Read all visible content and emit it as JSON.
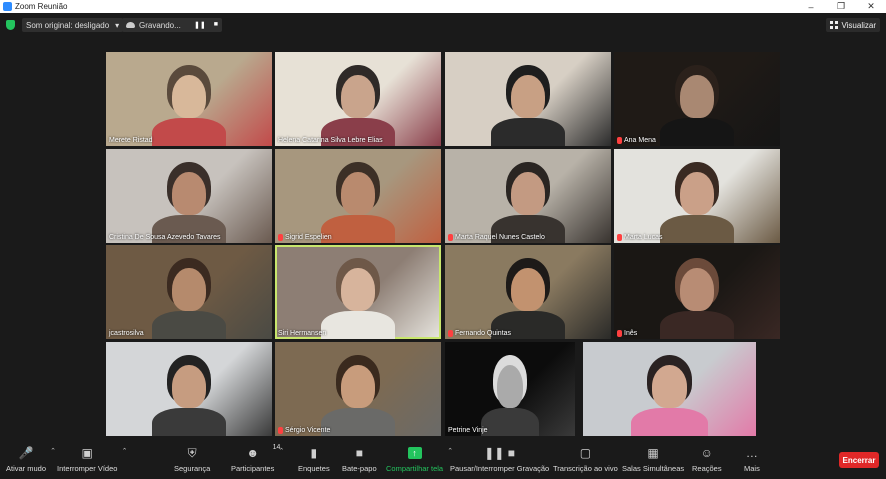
{
  "window": {
    "title": "Zoom Reunião"
  },
  "topbar": {
    "audio_label": "Som original: desligado",
    "recording_label": "Gravando...",
    "view_label": "Visualizar"
  },
  "participants": [
    {
      "name": "Merete Ristad",
      "muted": false,
      "active": false
    },
    {
      "name": "Helena Catarina Silva Lebre Elias",
      "muted": false,
      "active": false
    },
    {
      "name": "",
      "muted": false,
      "active": false
    },
    {
      "name": "Ana Mena",
      "muted": true,
      "active": false
    },
    {
      "name": "Cristina De Sousa Azevedo Tavares",
      "muted": false,
      "active": false
    },
    {
      "name": "Sigrid Espelien",
      "muted": true,
      "active": false
    },
    {
      "name": "Marta Raquel Nunes Castelo",
      "muted": true,
      "active": false
    },
    {
      "name": "Marta Lucas",
      "muted": true,
      "active": false
    },
    {
      "name": "jcastrosilva",
      "muted": false,
      "active": false
    },
    {
      "name": "Siri Hermansen",
      "muted": false,
      "active": true
    },
    {
      "name": "Fernando Quintas",
      "muted": true,
      "active": false
    },
    {
      "name": "Inês",
      "muted": true,
      "active": false
    },
    {
      "name": "",
      "muted": false,
      "active": false
    },
    {
      "name": "Sérgio Vicente",
      "muted": true,
      "active": false
    },
    {
      "name": "Petrine Vinje",
      "muted": false,
      "active": false
    },
    {
      "name": "",
      "muted": false,
      "active": false
    }
  ],
  "toolbar": {
    "mute": "Ativar mudo",
    "video": "Interromper Vídeo",
    "security": "Segurança",
    "participants": "Participantes",
    "participants_count": "14",
    "polls": "Enquetes",
    "chat": "Bate-papo",
    "share": "Compartilhar tela",
    "pause_recording": "Pausar/Interromper Gravação",
    "captions": "Transcrição ao vivo",
    "breakout": "Salas Simultâneas",
    "reactions": "Reações",
    "more": "Mais",
    "end": "Encerrar"
  },
  "colors": {
    "end": "#e02828",
    "share": "#23c45e",
    "active_border": "#c8e66c",
    "muted_mic": "#ff4040"
  }
}
